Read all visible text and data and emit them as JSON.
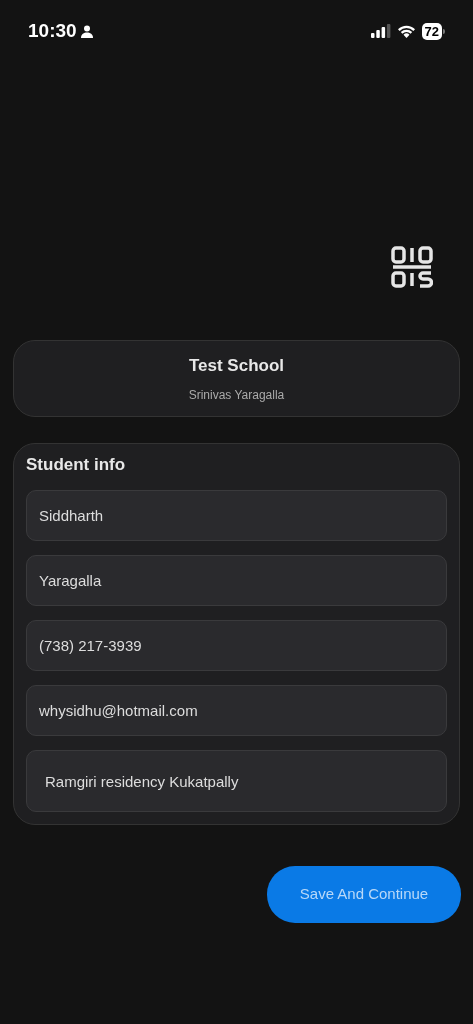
{
  "status_bar": {
    "time": "10:30",
    "battery": "72"
  },
  "school": {
    "name": "Test School",
    "person": "Srinivas Yaragalla"
  },
  "student_info": {
    "title": "Student info",
    "fields": [
      {
        "kind": "text",
        "value": "Siddharth"
      },
      {
        "kind": "text",
        "value": "Yaragalla"
      },
      {
        "kind": "text",
        "value": "(738) 217-3939"
      },
      {
        "kind": "text",
        "value": "whysidhu@hotmail.com"
      },
      {
        "kind": "multiline",
        "value": "Ramgiri residency Kukatpally"
      }
    ]
  },
  "button": "Save And Continue"
}
